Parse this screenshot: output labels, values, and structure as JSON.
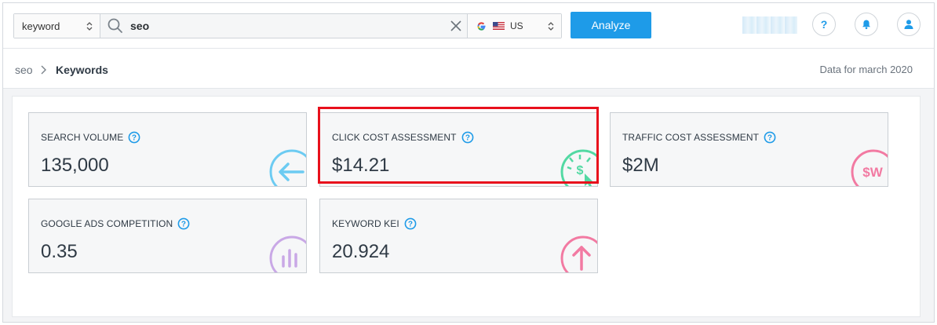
{
  "toolbar": {
    "type_select": "keyword",
    "search_value": "seo",
    "region_label": "US",
    "analyze_label": "Analyze"
  },
  "breadcrumb": {
    "root": "seo",
    "current": "Keywords",
    "data_for": "Data for march 2020"
  },
  "metrics": [
    {
      "label": "SEARCH VOLUME",
      "value": "135,000",
      "icon": "arrow-left-icon",
      "color": "#6ccbf2"
    },
    {
      "label": "CLICK COST ASSESSMENT",
      "value": "$14.21",
      "icon": "click-cost-icon",
      "color": "#52d9a3"
    },
    {
      "label": "TRAFFIC COST ASSESSMENT",
      "value": "$2M",
      "icon": "traffic-cost-icon",
      "color": "#f27aa2",
      "icon_text": "$W"
    },
    {
      "label": "GOOGLE ADS COMPETITION",
      "value": "0.35",
      "icon": "bar-chart-icon",
      "color": "#c9a8e6"
    },
    {
      "label": "KEYWORD KEI",
      "value": "20.924",
      "icon": "arrow-up-icon",
      "color": "#f27aa2"
    }
  ],
  "colors": {
    "accent": "#1e9be8",
    "highlight": "#e8101c",
    "help_icon": "#1e9be8"
  }
}
